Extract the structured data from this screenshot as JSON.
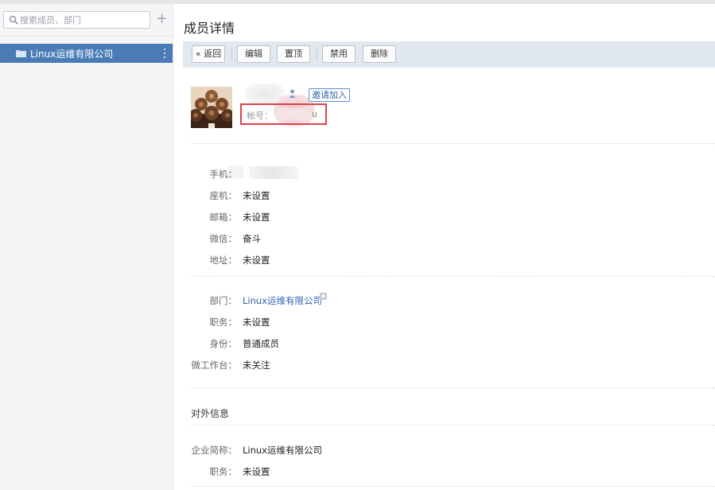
{
  "sidebar": {
    "search_placeholder": "搜索成员、部门",
    "add_label": "+",
    "departments": [
      {
        "label": "Linux运维有限公司"
      }
    ]
  },
  "main": {
    "title": "成员详情",
    "toolbar": {
      "back_label": "« 返回",
      "edit_label": "编辑",
      "pin_label": "置顶",
      "disable_label": "禁用",
      "delete_label": "删除"
    },
    "profile": {
      "invite_label": "邀请加入",
      "account_label": "帐号：",
      "account_tail": "u"
    },
    "contact": [
      {
        "label": "手机：",
        "value": ""
      },
      {
        "label": "座机：",
        "value": "未设置"
      },
      {
        "label": "邮箱：",
        "value": "未设置"
      },
      {
        "label": "微信：",
        "value": "奋斗"
      },
      {
        "label": "地址：",
        "value": "未设置"
      }
    ],
    "org": [
      {
        "label": "部门：",
        "value": "Linux运维有限公司"
      },
      {
        "label": "职务：",
        "value": "未设置"
      },
      {
        "label": "身份：",
        "value": "普通成员"
      },
      {
        "label": "微工作台：",
        "value": "未关注"
      }
    ],
    "external": {
      "title": "对外信息",
      "rows": [
        {
          "label": "企业简称：",
          "value": "Linux运维有限公司"
        },
        {
          "label": "职务：",
          "value": "未设置"
        }
      ]
    }
  },
  "colors": {
    "accent": "#4a7bb7",
    "toolbar_bg": "#e1e8f0",
    "link": "#2f64b0",
    "highlight_border": "#e0424a"
  }
}
